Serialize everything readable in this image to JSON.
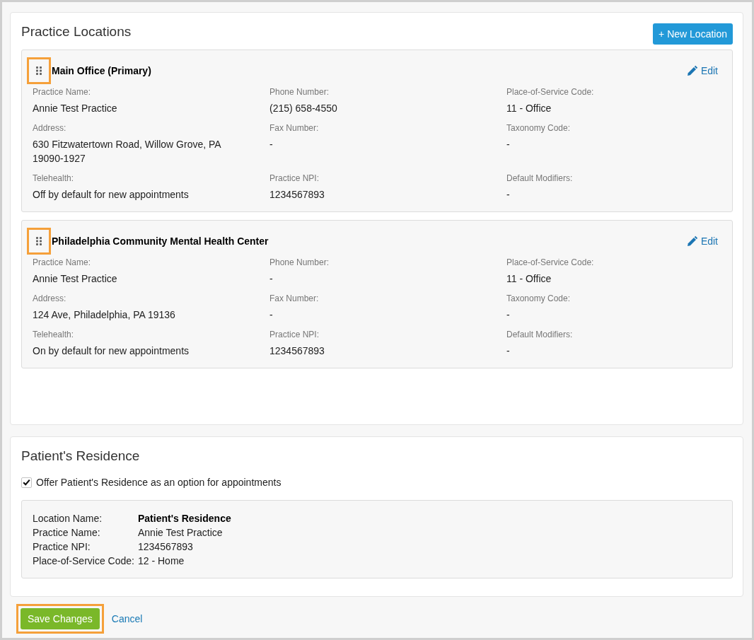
{
  "locations_panel": {
    "title": "Practice Locations",
    "new_button": "+ New Location",
    "locations": [
      {
        "name": "Main Office (Primary)",
        "handle_highlighted": true,
        "edit": "Edit",
        "fields": [
          {
            "label": "Practice Name:",
            "value": "Annie Test Practice"
          },
          {
            "label": "Phone Number:",
            "value": "(215) 658-4550"
          },
          {
            "label": "Place-of-Service Code:",
            "value": "11 - Office"
          },
          {
            "label": "Address:",
            "value": "630 Fitzwatertown Road, Willow Grove, PA 19090-1927"
          },
          {
            "label": "Fax Number:",
            "value": "-"
          },
          {
            "label": "Taxonomy Code:",
            "value": "-"
          },
          {
            "label": "Telehealth:",
            "value": "Off by default for new appointments"
          },
          {
            "label": "Practice NPI:",
            "value": "1234567893"
          },
          {
            "label": "Default Modifiers:",
            "value": "-"
          }
        ]
      },
      {
        "name": "Philadelphia Community Mental Health Center",
        "handle_highlighted": true,
        "edit": "Edit",
        "fields": [
          {
            "label": "Practice Name:",
            "value": "Annie Test Practice"
          },
          {
            "label": "Phone Number:",
            "value": "-"
          },
          {
            "label": "Place-of-Service Code:",
            "value": "11 - Office"
          },
          {
            "label": "Address:",
            "value": "124 Ave, Philadelphia, PA 19136"
          },
          {
            "label": "Fax Number:",
            "value": "-"
          },
          {
            "label": "Taxonomy Code:",
            "value": "-"
          },
          {
            "label": "Telehealth:",
            "value": "On by default for new appointments"
          },
          {
            "label": "Practice NPI:",
            "value": "1234567893"
          },
          {
            "label": "Default Modifiers:",
            "value": "-"
          }
        ]
      }
    ]
  },
  "residence_panel": {
    "title": "Patient's Residence",
    "offer": {
      "label": "Offer Patient's Residence as an option for appointments",
      "checked": true
    },
    "details": [
      {
        "kind": "name",
        "label": "Location Name:",
        "value": "Patient's Residence"
      },
      {
        "kind": "field",
        "label": "Practice Name:",
        "value": "Annie Test Practice"
      },
      {
        "kind": "field",
        "label": "Practice NPI:",
        "value": "1234567893"
      },
      {
        "kind": "field",
        "label": "Place-of-Service Code:",
        "value": "12 - Home"
      }
    ]
  },
  "footer": {
    "save": {
      "label": "Save Changes",
      "highlighted": true
    },
    "cancel": "Cancel"
  }
}
